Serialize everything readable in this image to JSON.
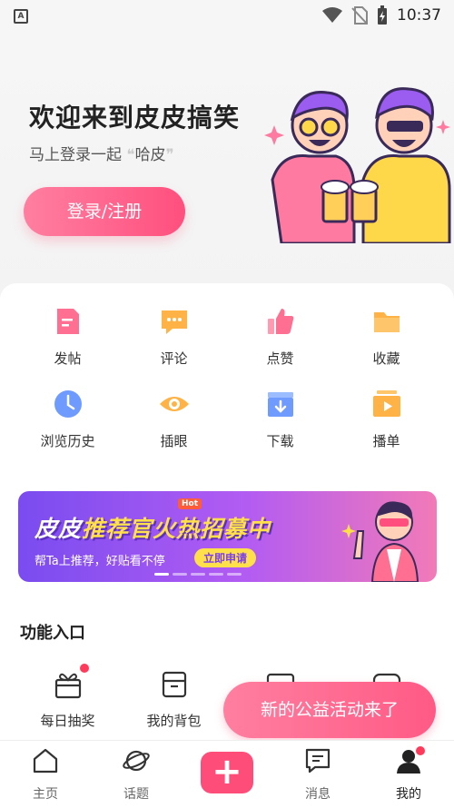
{
  "status_bar": {
    "app_icon_letter": "A",
    "time": "10:37"
  },
  "hero": {
    "title": "欢迎来到皮皮搞笑",
    "subtitle_prefix": "马上登录一起",
    "subtitle_quoted": "哈皮",
    "login_button": "登录/注册"
  },
  "quick_actions": [
    {
      "label": "发帖",
      "icon": "post-icon",
      "color": "#ff6f92"
    },
    {
      "label": "评论",
      "icon": "comment-icon",
      "color": "#ffb347"
    },
    {
      "label": "点赞",
      "icon": "thumbs-up-icon",
      "color": "#ff6f92"
    },
    {
      "label": "收藏",
      "icon": "folder-icon",
      "color": "#ffb347"
    },
    {
      "label": "浏览历史",
      "icon": "clock-icon",
      "color": "#6f9bff"
    },
    {
      "label": "插眼",
      "icon": "eye-icon",
      "color": "#ffb347"
    },
    {
      "label": "下载",
      "icon": "download-icon",
      "color": "#6f9bff"
    },
    {
      "label": "播单",
      "icon": "playlist-icon",
      "color": "#ffb347"
    }
  ],
  "banner": {
    "hot_tag": "Hot",
    "title_a": "皮皮",
    "title_b": "推荐官",
    "title_c": "火热招募中",
    "subtitle": "帮Ta上推荐，好贴看不停",
    "cta": "立即申请"
  },
  "functions": {
    "title": "功能入口",
    "items": [
      {
        "label": "每日抽奖",
        "icon": "gift-icon",
        "has_badge": true
      },
      {
        "label": "我的背包",
        "icon": "box-icon",
        "has_badge": false
      }
    ]
  },
  "toast": "新的公益活动来了",
  "tab_bar": {
    "tabs": [
      {
        "label": "主页",
        "icon": "home-icon"
      },
      {
        "label": "话题",
        "icon": "planet-icon"
      },
      {
        "label": "消息",
        "icon": "message-icon"
      },
      {
        "label": "我的",
        "icon": "profile-icon"
      }
    ],
    "add_symbol": "+"
  },
  "colors": {
    "accent": "#ff4d7a",
    "background": "#f6f6f6"
  }
}
